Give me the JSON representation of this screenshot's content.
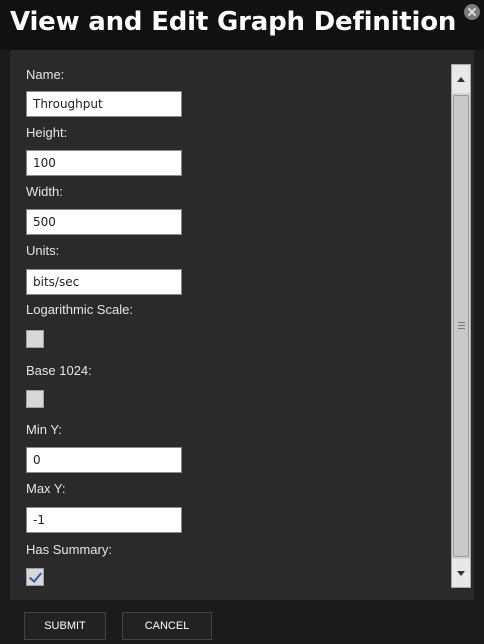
{
  "dialog": {
    "title": "View and Edit Graph Definition",
    "close_icon": "close-icon"
  },
  "form": {
    "name_label": "Name:",
    "name_value": "Throughput",
    "height_label": "Height:",
    "height_value": "100",
    "width_label": "Width:",
    "width_value": "500",
    "units_label": "Units:",
    "units_value": "bits/sec",
    "log_scale_label": "Logarithmic Scale:",
    "log_scale_checked": false,
    "base1024_label": "Base 1024:",
    "base1024_checked": false,
    "min_y_label": "Min Y:",
    "min_y_value": "0",
    "max_y_label": "Max Y:",
    "max_y_value": "-1",
    "has_summary_label": "Has Summary:",
    "has_summary_checked": true
  },
  "buttons": {
    "submit_label": "SUBMIT",
    "cancel_label": "CANCEL"
  },
  "colors": {
    "background": "#1b1b1b",
    "panel": "#2a2a2a",
    "title_text": "#ffffff",
    "check_mark": "#2b5fa8"
  }
}
